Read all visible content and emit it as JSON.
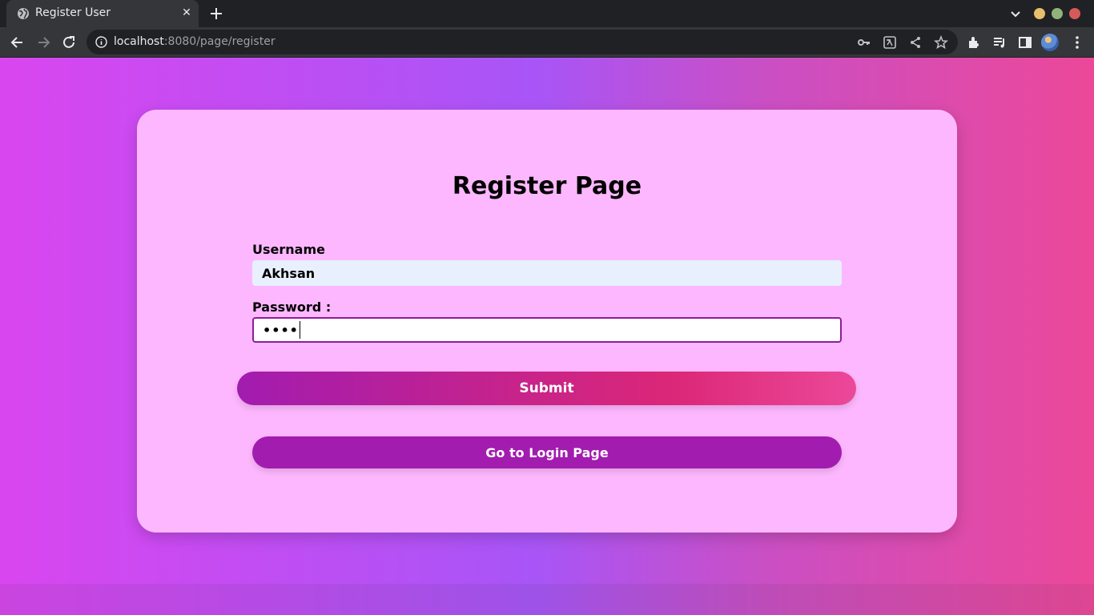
{
  "browser": {
    "tab_title": "Register User",
    "tab_close_glyph": "✕",
    "url_host": "localhost",
    "url_rest": ":8080/page/register",
    "icons": [
      "globe-icon",
      "new-tab-icon",
      "tab-search-icon",
      "back-icon",
      "forward-icon",
      "reload-icon",
      "info-icon",
      "key-icon",
      "translate-icon",
      "share-icon",
      "star-icon",
      "extensions-icon",
      "media-icon",
      "side-panel-icon",
      "profile-avatar",
      "more-icon"
    ],
    "window_controls": {
      "minimize": "#e6c06b",
      "maximize": "#8fb37a",
      "close": "#d65a5a"
    }
  },
  "page": {
    "title": "Register Page",
    "username_label": "Username",
    "username_value": "Akhsan",
    "password_label": "Password :",
    "password_value": "••••",
    "submit_label": "Submit",
    "login_label": "Go to Login Page"
  },
  "colors": {
    "card": "#fdb7fe",
    "accent": "#a21caf",
    "gradient_start": "#d946ef",
    "gradient_end": "#ec4899"
  }
}
